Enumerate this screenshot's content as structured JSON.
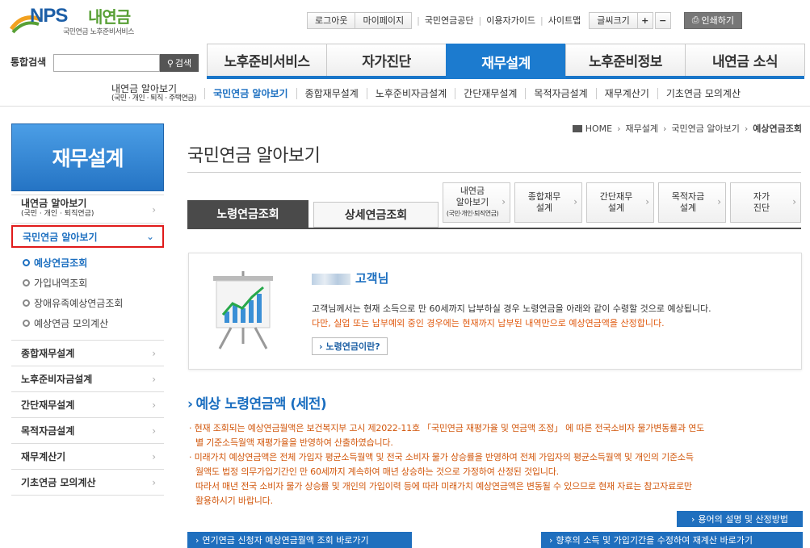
{
  "logo": {
    "brand": "NPS",
    "name": "내연금",
    "subtitle": "국민연금 노후준비서비스"
  },
  "top_links": {
    "logout": "로그아웃",
    "mypage": "마이페이지",
    "nps": "국민연금공단",
    "guide": "이용자가이드",
    "sitemap": "사이트맵",
    "font_size": "글씨크기",
    "plus": "+",
    "minus": "−",
    "print": "인쇄하기"
  },
  "search": {
    "label": "통합검색",
    "value": "",
    "button": "검색"
  },
  "main_nav": [
    "노후준비서비스",
    "자가진단",
    "재무설계",
    "노후준비정보",
    "내연금 소식"
  ],
  "sub_nav": {
    "first_line1": "내연금 알아보기",
    "first_line2": "(국민 · 개인 · 퇴직 · 주택연금)",
    "items": [
      "국민연금 알아보기",
      "종합재무설계",
      "노후준비자금설계",
      "간단재무설계",
      "목적자금설계",
      "재무계산기",
      "기초연금 모의계산"
    ]
  },
  "sidebar": {
    "title": "재무설계",
    "first_line1": "내연금 알아보기",
    "first_line2": "(국민 · 개인 · 퇴직연금)",
    "active": "국민연금 알아보기",
    "subitems": [
      "예상연금조회",
      "가입내역조회",
      "장애유족예상연금조회",
      "예상연금 모의계산"
    ],
    "items": [
      "종합재무설계",
      "노후준비자금설계",
      "간단재무설계",
      "목적자금설계",
      "재무계산기",
      "기초연금 모의계산"
    ]
  },
  "breadcrumb": {
    "home": "HOME",
    "l1": "재무설계",
    "l2": "국민연금 알아보기",
    "current": "예상연금조회"
  },
  "page_title": "국민연금 알아보기",
  "content_tabs": {
    "tab1": "노령연금조회",
    "tab2": "상세연금조회"
  },
  "quick_links": {
    "q1_line1": "내연금",
    "q1_line2": "알아보기",
    "q1_line3": "(국민·개인·퇴직연금)",
    "q2_line1": "종합재무",
    "q2_line2": "설계",
    "q3_line1": "간단재무",
    "q3_line2": "설계",
    "q4_line1": "목적자금",
    "q4_line2": "설계",
    "q5_line1": "자가",
    "q5_line2": "진단"
  },
  "info": {
    "customer_suffix": "고객님",
    "text1": "고객님께서는 현재 소득으로 만 60세까지 납부하실 경우 노령연금을 아래와 같이 수령할 것으로 예상됩니다.",
    "text2": "다만, 실업 또는 납부예외 중인 경우에는 현재까지 납부된 내역만으로 예상연금액을 산정합니다.",
    "button": "노령연금이란?"
  },
  "section": {
    "title": "예상 노령연금액 (세전)",
    "note1a": "· 현재 조회되는 예상연금월액은 보건복지부 고시 제2022-11호 「국민연금 재평가율 및 연금액 조정」 에 따른 전국소비자 물가변동률과 연도",
    "note1b": "별 기준소득월액 재평가율을 반영하여 산출하였습니다.",
    "note2a": "· 미래가치 예상연금액은 전체 가입자 평균소득월액 및 전국 소비자 물가 상승률을 반영하여 전체 가입자의 평균소득월액 및 개인의 기준소득",
    "note2b": "월액도 법정 의무가입기간인 만 60세까지 계속하여 매년 상승하는 것으로 가정하여 산정된 것입니다.",
    "note2c": "따라서 매년 전국 소비자 물가 상승률 및 개인의 가입이력 등에 따라 미래가치 예상연금액은 변동될 수 있으므로 현재 자료는 참고자료로만",
    "note2d": "활용하시기 바랍니다.",
    "terms_button": "용어의 설명 및 산정방법",
    "bottom_btn1": "연기연금 신청자 예상연금월액 조회 바로가기",
    "bottom_btn2": "향후의 소득 및 가입기간을 수정하여 재계산 바로가기"
  }
}
